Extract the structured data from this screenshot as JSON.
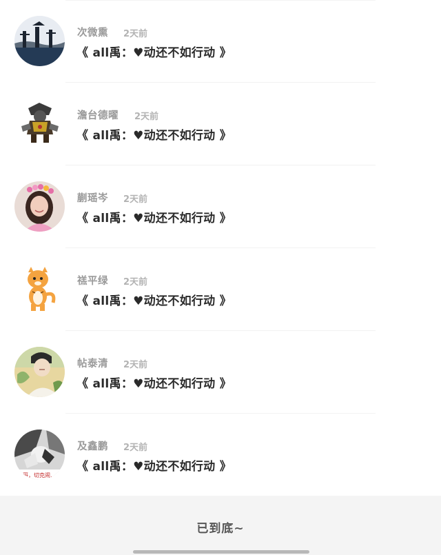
{
  "comments": [
    {
      "username": "次微熏",
      "time": "2天前",
      "text": "《 all禹：♥动还不如行动 》",
      "avatar_icon": "avatar-landscape-figures"
    },
    {
      "username": "澹台德曜",
      "time": "2天前",
      "text": "《 all禹：♥动还不如行动 》",
      "avatar_icon": "avatar-armored-character"
    },
    {
      "username": "蒯瑶岑",
      "time": "2天前",
      "text": "《 all禹：♥动还不如行动 》",
      "avatar_icon": "avatar-girl-flower-crown"
    },
    {
      "username": "禚平绿",
      "time": "2天前",
      "text": "《 all禹：♥动还不如行动 》",
      "avatar_icon": "avatar-cartoon-tiger"
    },
    {
      "username": "帖泰清",
      "time": "2天前",
      "text": "《 all禹：♥动还不如行动 》",
      "avatar_icon": "avatar-illustrated-boy"
    },
    {
      "username": "及鑫鹏",
      "time": "2天前",
      "text": "《 all禹：♥动还不如行动 》",
      "avatar_icon": "avatar-bw-photo"
    }
  ],
  "footer": {
    "end_text": "已到底~"
  },
  "avatar_sticker_text": "哥，切克闹…"
}
